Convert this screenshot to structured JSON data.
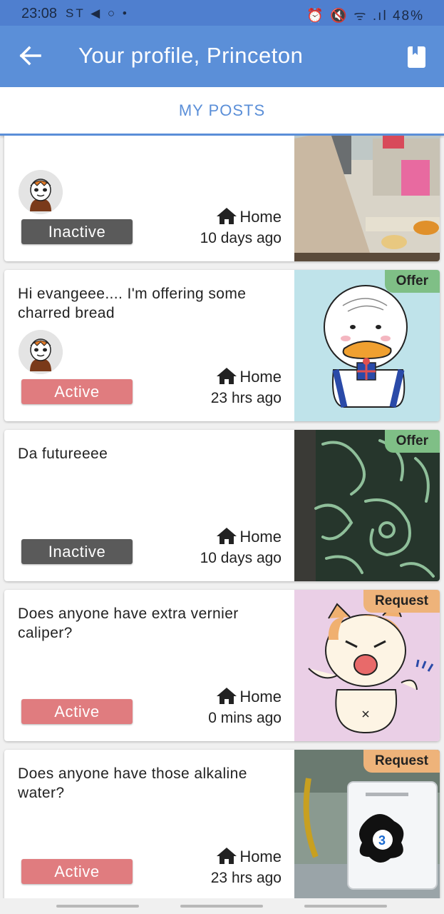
{
  "status_bar": {
    "time": "23:08",
    "notifications": "ST ◀ ○ •",
    "indicators": "⏰ 🔇 ᯤ .ıl 48%",
    "battery": "48%"
  },
  "app_bar": {
    "title": "Your profile, Princeton",
    "back_icon": "arrow-left-icon",
    "bookmark_icon": "bookmark-icon"
  },
  "tabs": [
    {
      "label": "MY POSTS",
      "selected": true
    }
  ],
  "colors": {
    "app_bar": "#5b8fd8",
    "status_bar": "#4f7fcf",
    "inactive_badge": "#5a5a5a",
    "active_badge": "#e07c7f",
    "offer_tag": "#7fbf86",
    "request_tag": "#eeb37a"
  },
  "posts": [
    {
      "message": "",
      "status": "Inactive",
      "location": "Home",
      "time_ago": "10 days ago",
      "type": "",
      "has_avatar": true,
      "image": "photo-kitchen-cooking"
    },
    {
      "message": "Hi evangeee.... I'm offering some charred bread",
      "status": "Active",
      "location": "Home",
      "time_ago": "23 hrs ago",
      "type": "Offer",
      "has_avatar": true,
      "image": "cartoon-duck-with-gift"
    },
    {
      "message": "Da futureeee",
      "status": "Inactive",
      "location": "Home",
      "time_ago": "10 days ago",
      "type": "Offer",
      "has_avatar": false,
      "image": "photo-green-patterned-fabric"
    },
    {
      "message": "Does anyone have extra vernier caliper?",
      "status": "Active",
      "location": "Home",
      "time_ago": "0 mins ago",
      "type": "Request",
      "has_avatar": false,
      "image": "cartoon-cat-angry"
    },
    {
      "message": "Does anyone have those alkaline water?",
      "status": "Active",
      "location": "Home",
      "time_ago": "23 hrs ago",
      "type": "Request",
      "has_avatar": false,
      "image": "photo-water-filter-machine"
    }
  ]
}
